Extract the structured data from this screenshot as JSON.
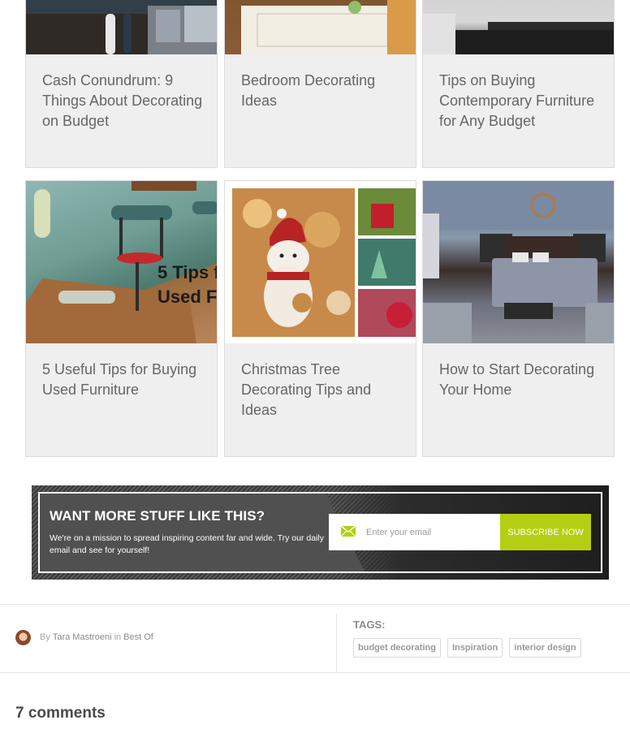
{
  "articles": [
    {
      "title": "Cash Conundrum: 9 Things About Decorating on Budget",
      "image_alt": "living room"
    },
    {
      "title": "Bedroom Decorating Ideas",
      "image_alt": "bedroom"
    },
    {
      "title": "Tips on Buying Contemporary Furniture for Any Budget",
      "image_alt": "modern interior"
    },
    {
      "title": "5 Useful Tips for Buying Used Furniture",
      "image_alt": "chairs",
      "overlay_text": [
        "5 Tips f",
        "Used F"
      ]
    },
    {
      "title": "Christmas Tree Decorating Tips and Ideas",
      "image_alt": "christmas collage"
    },
    {
      "title": "How to Start Decorating Your Home",
      "image_alt": "bedroom"
    }
  ],
  "newsletter": {
    "heading": "WANT MORE STUFF LIKE THIS?",
    "text": "We're on a mission to spread inspiring content far and wide. Try our daily email and see for yourself!",
    "email_placeholder": "Enter your email",
    "button_label": "SUBSCRIBE NOW",
    "accent_color": "#b4cf11"
  },
  "meta": {
    "by_prefix": "By",
    "author": "Tara Mastroeni",
    "in_word": "in",
    "category": "Best Of",
    "tags_label": "TAGS:",
    "tags": [
      "budget decorating",
      "Inspiration",
      "interior design"
    ]
  },
  "comments_heading": "7 comments"
}
